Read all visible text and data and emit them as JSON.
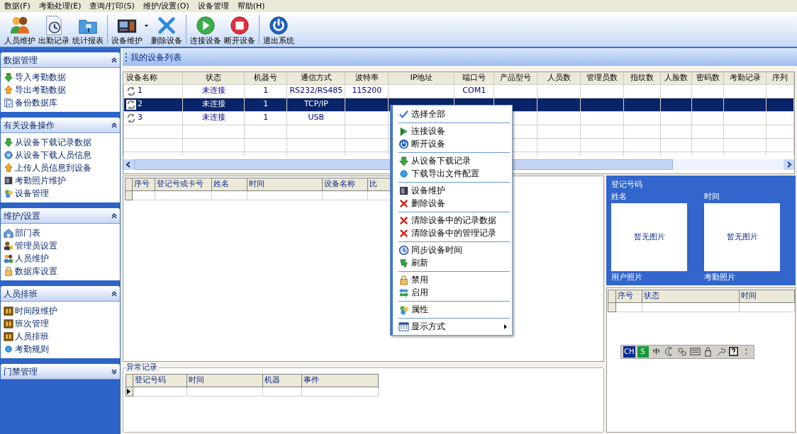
{
  "menu_bar": [
    "数据(F)",
    "考勤处理(E)",
    "查询/打印(S)",
    "维护/设置(O)",
    "设备管理",
    "帮助(H)"
  ],
  "toolbar": {
    "groups": [
      [
        {
          "label": "人员维护",
          "dropdown": false
        },
        {
          "label": "出勤记录",
          "dropdown": false
        },
        {
          "label": "统计报表",
          "dropdown": false
        }
      ],
      [
        {
          "label": "设备维护",
          "dropdown": true
        },
        {
          "label": "删除设备",
          "dropdown": false
        }
      ],
      [
        {
          "label": "连接设备",
          "dropdown": false
        },
        {
          "label": "断开设备",
          "dropdown": false
        }
      ],
      [
        {
          "label": "退出系统",
          "dropdown": false
        }
      ]
    ]
  },
  "sidebar": {
    "sections": [
      {
        "title": "数据管理",
        "expanded": true,
        "items": [
          "导入考勤数据",
          "导出考勤数据",
          "备份数据库"
        ]
      },
      {
        "title": "有关设备操作",
        "expanded": true,
        "items": [
          "从设备下载记录数据",
          "从设备下载人员信息",
          "上传人员信息到设备",
          "考勤照片维护",
          "设备管理"
        ]
      },
      {
        "title": "维护/设置",
        "expanded": true,
        "items": [
          "部门表",
          "管理员设置",
          "人员维护",
          "数据库设置"
        ]
      },
      {
        "title": "人员排班",
        "expanded": true,
        "items": [
          "时间段维护",
          "班次管理",
          "人员排班",
          "考勤规则"
        ]
      },
      {
        "title": "门禁管理",
        "expanded": false
      }
    ]
  },
  "device_list": {
    "title": "我的设备列表",
    "columns": [
      "设备名称",
      "状态",
      "机器号",
      "通信方式",
      "波特率",
      "IP地址",
      "端口号",
      "产品型号",
      "人员数",
      "管理员数",
      "指纹数",
      "人脸数",
      "密码数",
      "考勤记录",
      "序列"
    ],
    "rows": [
      {
        "name": "1",
        "status": "未连接",
        "machine_no": "1",
        "comm": "RS232/RS485",
        "baud": "115200",
        "port": "COM1",
        "selected": false
      },
      {
        "name": "2",
        "status": "未连接",
        "machine_no": "1",
        "comm": "TCP/IP",
        "selected": true
      },
      {
        "name": "3",
        "status": "未连接",
        "machine_no": "1",
        "comm": "USB",
        "selected": false
      }
    ]
  },
  "context_menu": {
    "groups": [
      [
        {
          "label": "选择全部",
          "submenu": false
        }
      ],
      [
        {
          "label": "连接设备",
          "submenu": false
        },
        {
          "label": "断开设备",
          "submenu": false
        }
      ],
      [
        {
          "label": "从设备下载记录",
          "submenu": false
        },
        {
          "label": "下载导出文件配置",
          "submenu": false
        }
      ],
      [
        {
          "label": "设备维护",
          "submenu": false
        },
        {
          "label": "删除设备",
          "submenu": false
        }
      ],
      [
        {
          "label": "清除设备中的记录数据",
          "submenu": false
        },
        {
          "label": "清除设备中的管理记录",
          "submenu": false
        }
      ],
      [
        {
          "label": "同步设备时间",
          "submenu": false
        },
        {
          "label": "刷新",
          "submenu": false
        }
      ],
      [
        {
          "label": "禁用",
          "submenu": false
        },
        {
          "label": "启用",
          "submenu": false
        }
      ],
      [
        {
          "label": "属性",
          "submenu": false
        }
      ],
      [
        {
          "label": "显示方式",
          "submenu": true
        }
      ]
    ]
  },
  "records_table": {
    "columns": [
      "序号",
      "登记号或卡号",
      "姓名",
      "时间",
      "设备名称",
      "比"
    ]
  },
  "photo_panel": {
    "reg_no_label": "登记号码",
    "name_label": "姓名",
    "time_label": "时间",
    "photos": [
      {
        "placeholder": "暂无图片",
        "caption": "用户照片"
      },
      {
        "placeholder": "暂无图片",
        "caption": "考勤照片"
      }
    ]
  },
  "status_table": {
    "columns": [
      "序号",
      "状态",
      "时间"
    ]
  },
  "ime_bar": {
    "labels": [
      "CH",
      "S",
      "中"
    ]
  },
  "abnormal_records": {
    "title": "异常记录",
    "columns": [
      "登记号码",
      "时间",
      "机器",
      "事件"
    ]
  }
}
